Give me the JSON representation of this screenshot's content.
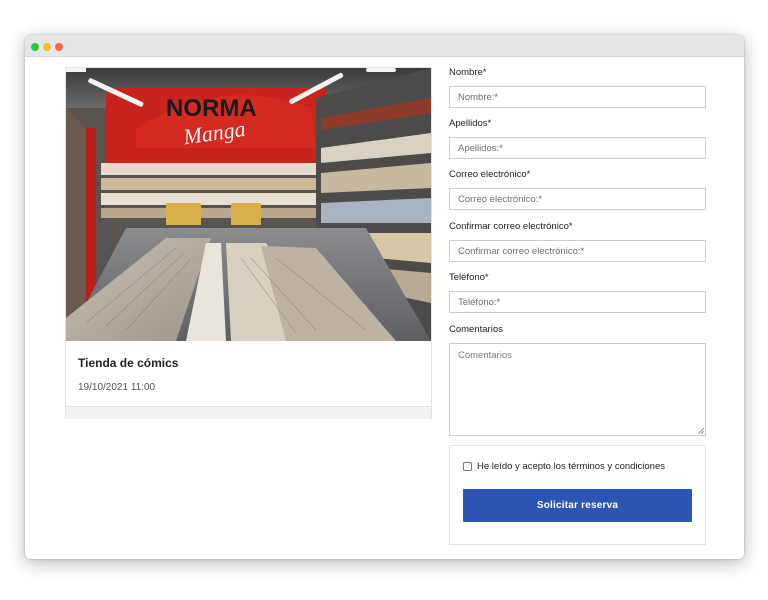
{
  "window": {
    "controls": [
      "close",
      "minimize",
      "zoom"
    ]
  },
  "event": {
    "image_sign_text": [
      "NORMA",
      "Manga"
    ],
    "title": "Tienda de cómics",
    "datetime": "19/10/2021 11:00"
  },
  "form": {
    "fields": [
      {
        "label": "Nombre*",
        "placeholder": "Nombre:*",
        "value": ""
      },
      {
        "label": "Apellidos*",
        "placeholder": "Apellidos:*",
        "value": ""
      },
      {
        "label": "Correo electrónico*",
        "placeholder": "Correo electrónico:*",
        "value": ""
      },
      {
        "label": "Confirmar correo electrónico*",
        "placeholder": "Confirmar correo electrónico:*",
        "value": ""
      },
      {
        "label": "Teléfono*",
        "placeholder": "Teléfono:*",
        "value": ""
      }
    ],
    "comments": {
      "label": "Comentarios",
      "placeholder": "Comentarios"
    },
    "terms": {
      "label": "He leído y acepto los términos y condiciones",
      "checked": false
    },
    "submit_label": "Solicitar reserva",
    "accent_color": "#2d56b2"
  }
}
